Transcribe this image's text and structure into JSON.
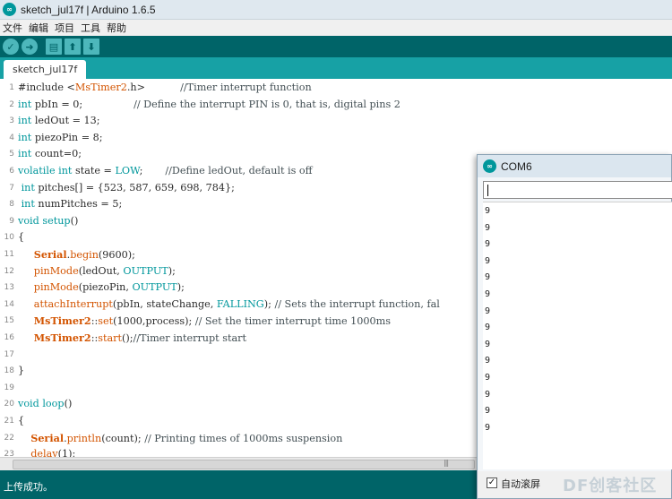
{
  "window": {
    "title": "sketch_jul17f | Arduino 1.6.5",
    "icon": "arduino-icon"
  },
  "menu": {
    "items": [
      "文件",
      "编辑",
      "项目",
      "工具",
      "帮助"
    ]
  },
  "toolbar": {
    "buttons": [
      {
        "name": "verify-button",
        "glyph": "✓"
      },
      {
        "name": "upload-button",
        "glyph": "➜"
      },
      {
        "name": "new-button",
        "glyph": "▤"
      },
      {
        "name": "open-button",
        "glyph": "⬆"
      },
      {
        "name": "save-button",
        "glyph": "⬇"
      }
    ]
  },
  "tabs": [
    {
      "label": "sketch_jul17f"
    }
  ],
  "editor": {
    "lines": [
      {
        "n": "1",
        "segs": [
          [
            "",
            "#include <"
          ],
          [
            "lib",
            "MsTimer2"
          ],
          [
            "",
            ".h>           "
          ],
          [
            "cmt",
            "//Timer interrupt function"
          ]
        ]
      },
      {
        "n": "2",
        "segs": [
          [
            "kw",
            "int"
          ],
          [
            "",
            " pbIn = 0;                "
          ],
          [
            "cmt",
            "// Define the interrupt PIN is 0, that is, digital pins 2"
          ]
        ]
      },
      {
        "n": "3",
        "segs": [
          [
            "kw",
            "int"
          ],
          [
            "",
            " ledOut = 13;"
          ]
        ]
      },
      {
        "n": "4",
        "segs": [
          [
            "kw",
            "int"
          ],
          [
            "",
            " piezoPin = 8;"
          ]
        ]
      },
      {
        "n": "5",
        "segs": [
          [
            "kw",
            "int"
          ],
          [
            "",
            " count=0;"
          ]
        ]
      },
      {
        "n": "6",
        "segs": [
          [
            "kw",
            "volatile"
          ],
          [
            "",
            " "
          ],
          [
            "kw",
            "int"
          ],
          [
            "",
            " state = "
          ],
          [
            "const",
            "LOW"
          ],
          [
            "",
            ";       "
          ],
          [
            "cmt",
            "//Define ledOut, default is off"
          ]
        ]
      },
      {
        "n": "7",
        "segs": [
          [
            "",
            " "
          ],
          [
            "kw",
            "int"
          ],
          [
            "",
            " pitches[] = {523, 587, 659, 698, 784};"
          ]
        ]
      },
      {
        "n": "8",
        "segs": [
          [
            "",
            " "
          ],
          [
            "kw",
            "int"
          ],
          [
            "",
            " numPitches = 5;"
          ]
        ]
      },
      {
        "n": "9",
        "segs": [
          [
            "kw",
            "void"
          ],
          [
            "",
            " "
          ],
          [
            "kw",
            "setup"
          ],
          [
            "",
            "()"
          ]
        ]
      },
      {
        "n": "10",
        "segs": [
          [
            "",
            "{"
          ]
        ]
      },
      {
        "n": "11",
        "segs": [
          [
            "",
            "     "
          ],
          [
            "cls",
            "Serial"
          ],
          [
            "",
            "."
          ],
          [
            "fn",
            "begin"
          ],
          [
            "",
            "(9600);"
          ]
        ]
      },
      {
        "n": "12",
        "segs": [
          [
            "",
            "     "
          ],
          [
            "fn",
            "pinMode"
          ],
          [
            "",
            "(ledOut, "
          ],
          [
            "const",
            "OUTPUT"
          ],
          [
            "",
            ");"
          ]
        ]
      },
      {
        "n": "13",
        "segs": [
          [
            "",
            "     "
          ],
          [
            "fn",
            "pinMode"
          ],
          [
            "",
            "(piezoPin, "
          ],
          [
            "const",
            "OUTPUT"
          ],
          [
            "",
            ");"
          ]
        ]
      },
      {
        "n": "14",
        "segs": [
          [
            "",
            "     "
          ],
          [
            "fn",
            "attachInterrupt"
          ],
          [
            "",
            "(pbIn, stateChange, "
          ],
          [
            "const",
            "FALLING"
          ],
          [
            "",
            "); "
          ],
          [
            "cmt",
            "// Sets the interrupt function, fal"
          ]
        ]
      },
      {
        "n": "15",
        "segs": [
          [
            "",
            "     "
          ],
          [
            "cls",
            "MsTimer2"
          ],
          [
            "",
            "::"
          ],
          [
            "fn",
            "set"
          ],
          [
            "",
            "(1000,process); "
          ],
          [
            "cmt",
            "// Set the timer interrupt time 1000ms"
          ]
        ]
      },
      {
        "n": "16",
        "segs": [
          [
            "",
            "     "
          ],
          [
            "cls",
            "MsTimer2"
          ],
          [
            "",
            "::"
          ],
          [
            "fn",
            "start"
          ],
          [
            "",
            "();"
          ],
          [
            "cmt",
            "//Timer interrupt start"
          ]
        ]
      },
      {
        "n": "17",
        "segs": []
      },
      {
        "n": "18",
        "segs": [
          [
            "",
            "}"
          ]
        ]
      },
      {
        "n": "19",
        "segs": []
      },
      {
        "n": "20",
        "segs": [
          [
            "kw",
            "void"
          ],
          [
            "",
            " "
          ],
          [
            "kw",
            "loop"
          ],
          [
            "",
            "()"
          ]
        ]
      },
      {
        "n": "21",
        "segs": [
          [
            "",
            "{"
          ]
        ]
      },
      {
        "n": "22",
        "segs": [
          [
            "",
            "    "
          ],
          [
            "cls",
            "Serial"
          ],
          [
            "",
            "."
          ],
          [
            "fn",
            "println"
          ],
          [
            "",
            "(count); "
          ],
          [
            "cmt",
            "// Printing times of 1000ms suspension"
          ]
        ]
      },
      {
        "n": "23",
        "segs": [
          [
            "",
            "    "
          ],
          [
            "fn",
            "delay"
          ],
          [
            "",
            "(1);"
          ]
        ]
      }
    ]
  },
  "status": {
    "message": "上传成功。"
  },
  "serial_monitor": {
    "title": "COM6",
    "input_value": "",
    "output_lines": [
      "9",
      "9",
      "9",
      "9",
      "9",
      "9",
      "9",
      "9",
      "9",
      "9",
      "9",
      "9",
      "9",
      "9"
    ],
    "autoscroll": {
      "label": "自动滚屏",
      "checked": true
    },
    "watermark": "DF创客社区"
  },
  "colors": {
    "accent": "#00979c",
    "toolbar": "#006468",
    "tabbar": "#17a1a5"
  }
}
